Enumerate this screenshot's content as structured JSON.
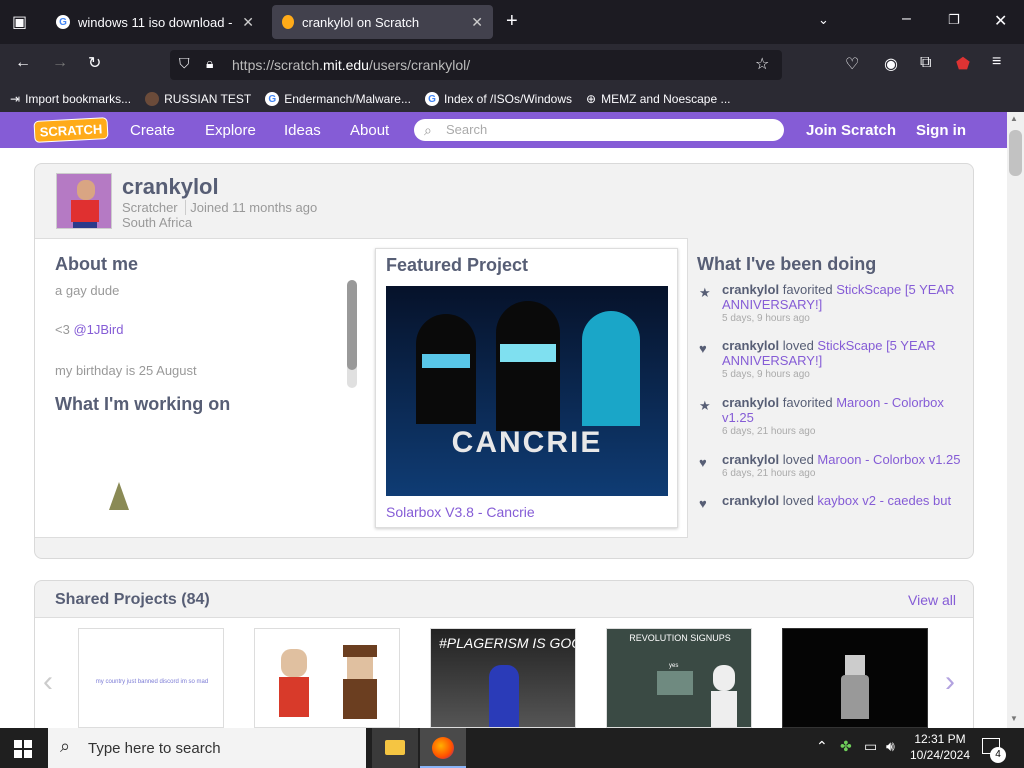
{
  "browser": {
    "tabs": [
      {
        "title": "windows 11 iso download - Goo",
        "active": false
      },
      {
        "title": "crankylol on Scratch",
        "active": true
      }
    ],
    "url_prefix": "https://scratch.",
    "url_domain": "mit.edu",
    "url_suffix": "/users/crankylol/",
    "extension_badge": "5",
    "bookmarks": [
      {
        "label": "Import bookmarks...",
        "icon": "import-icon"
      },
      {
        "label": "RUSSIAN TEST",
        "icon": "russian-icon"
      },
      {
        "label": "Endermanch/Malware...",
        "icon": "google-icon"
      },
      {
        "label": "Index of /ISOs/Windows",
        "icon": "google-icon"
      },
      {
        "label": "MEMZ and Noescape ...",
        "icon": "globe-icon"
      }
    ]
  },
  "scratch_nav": {
    "logo": "SCRATCH",
    "links": [
      "Create",
      "Explore",
      "Ideas",
      "About"
    ],
    "search_placeholder": "Search",
    "join": "Join Scratch",
    "signin": "Sign in"
  },
  "profile": {
    "username": "crankylol",
    "role": "Scratcher",
    "joined": "Joined 11 months ago",
    "location": "South Africa",
    "about_heading": "About me",
    "about_lines": [
      "a gay dude",
      "<3 @1JBird",
      "my birthday is 25 August"
    ],
    "about_line2_prefix": "<3 ",
    "about_line2_mention": "@1JBird",
    "working_heading": "What I'm working on",
    "featured_heading": "Featured Project",
    "featured_image_text": "CANCRIE",
    "featured_title": "Solarbox V3.8 - Cancrie",
    "activity_heading": "What I've been doing",
    "activity": [
      {
        "icon": "star-icon",
        "user": "crankylol",
        "action": "favorited",
        "target": "StickScape [5 YEAR ANNIVERSARY!]",
        "time": "5 days, 9 hours ago"
      },
      {
        "icon": "heart-icon",
        "user": "crankylol",
        "action": "loved",
        "target": "StickScape [5 YEAR ANNIVERSARY!]",
        "time": "5 days, 9 hours ago"
      },
      {
        "icon": "star-icon",
        "user": "crankylol",
        "action": "favorited",
        "target": "Maroon - Colorbox v1.25",
        "time": "6 days, 21 hours ago"
      },
      {
        "icon": "heart-icon",
        "user": "crankylol",
        "action": "loved",
        "target": "Maroon - Colorbox v1.25",
        "time": "6 days, 21 hours ago"
      },
      {
        "icon": "heart-icon",
        "user": "crankylol",
        "action": "loved",
        "target": "kaybox v2 - caedes but",
        "time": ""
      }
    ]
  },
  "shared": {
    "heading": "Shared Projects (84)",
    "view_all": "View all",
    "thumb1_text": "my country just banned discord im so mad",
    "thumb3_text": "#PLAGERISM IS GOOD",
    "thumb4_text": "REVOLUTION SIGNUPS",
    "thumb4_sub": "yes"
  },
  "taskbar": {
    "search_placeholder": "Type here to search",
    "time": "12:31 PM",
    "date": "10/24/2024",
    "notif_count": "4"
  }
}
